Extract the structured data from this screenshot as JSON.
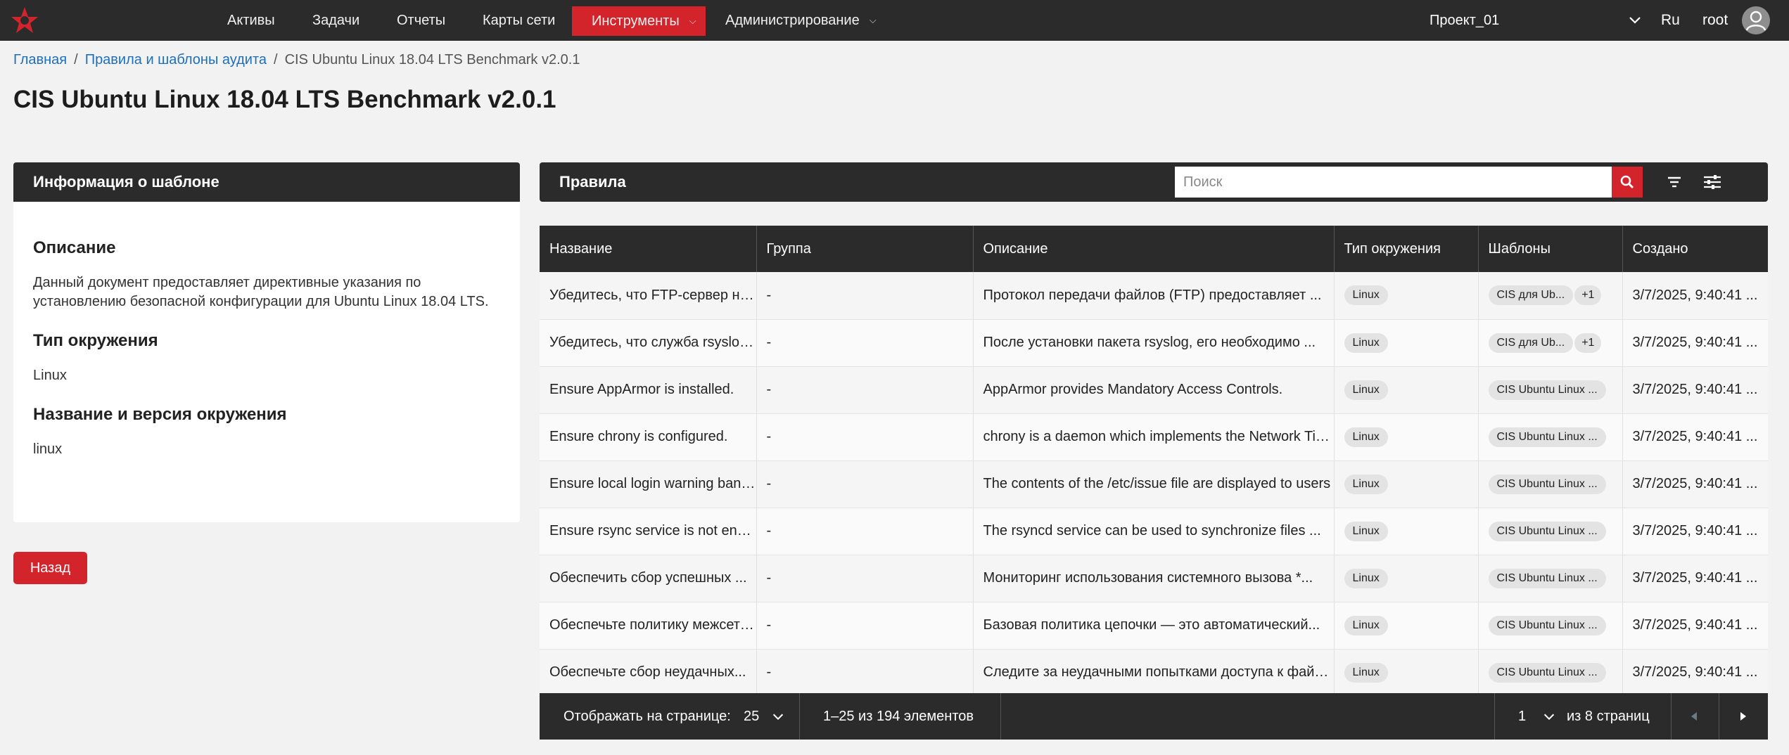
{
  "nav": {
    "items": [
      {
        "label": "Активы"
      },
      {
        "label": "Задачи"
      },
      {
        "label": "Отчеты"
      },
      {
        "label": "Карты сети"
      },
      {
        "label": "Инструменты"
      },
      {
        "label": "Администрирование"
      }
    ],
    "project": "Проект_01",
    "lang": "Ru",
    "user": "root"
  },
  "breadcrumb": {
    "home": "Главная",
    "parent": "Правила и шаблоны аудита",
    "current": "CIS Ubuntu Linux 18.04 LTS Benchmark v2.0.1"
  },
  "page_title": "CIS Ubuntu Linux 18.04 LTS Benchmark v2.0.1",
  "info_panel": {
    "title": "Информация о шаблоне",
    "description_heading": "Описание",
    "description": "Данный документ предоставляет директивные указания по установлению безопасной конфигурации для Ubuntu Linux 18.04 LTS.",
    "env_type_heading": "Тип окружения",
    "env_type": "Linux",
    "env_name_heading": "Название и версия окружения",
    "env_name": "linux"
  },
  "back_button": "Назад",
  "rules": {
    "title": "Правила",
    "search_placeholder": "Поиск",
    "columns": [
      "Название",
      "Группа",
      "Описание",
      "Тип окружения",
      "Шаблоны",
      "Создано"
    ],
    "rows": [
      {
        "name": "Убедитесь, что FTP-сервер не установлен",
        "group": "-",
        "description": "Протокол передачи файлов (FTP) предоставляет ...",
        "env": "Linux",
        "templates": [
          "CIS для Ub...",
          "+1"
        ],
        "created": "3/7/2025, 9:40:41 ..."
      },
      {
        "name": "Убедитесь, что служба rsyslog ...",
        "group": "-",
        "description": "После установки пакета rsyslog, его необходимо ...",
        "env": "Linux",
        "templates": [
          "CIS для Ub...",
          "+1"
        ],
        "created": "3/7/2025, 9:40:41 ..."
      },
      {
        "name": "Ensure AppArmor is installed.",
        "group": "-",
        "description": "AppArmor provides Mandatory Access Controls.",
        "env": "Linux",
        "templates": [
          "CIS Ubuntu Linux ..."
        ],
        "created": "3/7/2025, 9:40:41 ..."
      },
      {
        "name": "Ensure chrony is configured.",
        "group": "-",
        "description": "chrony is a daemon which implements the Network Time Protocol",
        "env": "Linux",
        "templates": [
          "CIS Ubuntu Linux ..."
        ],
        "created": "3/7/2025, 9:40:41 ..."
      },
      {
        "name": "Ensure local login warning banner is configured",
        "group": "-",
        "description": "The contents of the /etc/issue file are displayed to users",
        "env": "Linux",
        "templates": [
          "CIS Ubuntu Linux ..."
        ],
        "created": "3/7/2025, 9:40:41 ..."
      },
      {
        "name": "Ensure rsync service is not enabled",
        "group": "-",
        "description": "The rsyncd service can be used to synchronize files ...",
        "env": "Linux",
        "templates": [
          "CIS Ubuntu Linux ..."
        ],
        "created": "3/7/2025, 9:40:41 ..."
      },
      {
        "name": "Обеспечить сбор успешных ...",
        "group": "-",
        "description": "Мониторинг использования системного вызова *...",
        "env": "Linux",
        "templates": [
          "CIS Ubuntu Linux ..."
        ],
        "created": "3/7/2025, 9:40:41 ..."
      },
      {
        "name": "Обеспечьте политику межсетевого экрана",
        "group": "-",
        "description": "Базовая политика цепочки — это автоматический...",
        "env": "Linux",
        "templates": [
          "CIS Ubuntu Linux ..."
        ],
        "created": "3/7/2025, 9:40:41 ..."
      },
      {
        "name": "Обеспечьте сбор неудачных...",
        "group": "-",
        "description": "Следите за неудачными попытками доступа к файлам",
        "env": "Linux",
        "templates": [
          "CIS Ubuntu Linux ..."
        ],
        "created": "3/7/2025, 9:40:41 ..."
      }
    ]
  },
  "pager": {
    "per_page_label": "Отображать на странице:",
    "per_page_value": "25",
    "range": "1–25 из 194 элементов",
    "page": "1",
    "pages_label": "из 8 страниц"
  },
  "colors": {
    "accent": "#d3242c",
    "dark": "#2b2b2b",
    "link": "#1e6fb8"
  },
  "icons": [
    "star-logo-icon",
    "chevron-down-icon",
    "avatar-icon",
    "search-icon",
    "filter-icon",
    "settings-sliders-icon",
    "prev-page-icon",
    "next-page-icon"
  ]
}
